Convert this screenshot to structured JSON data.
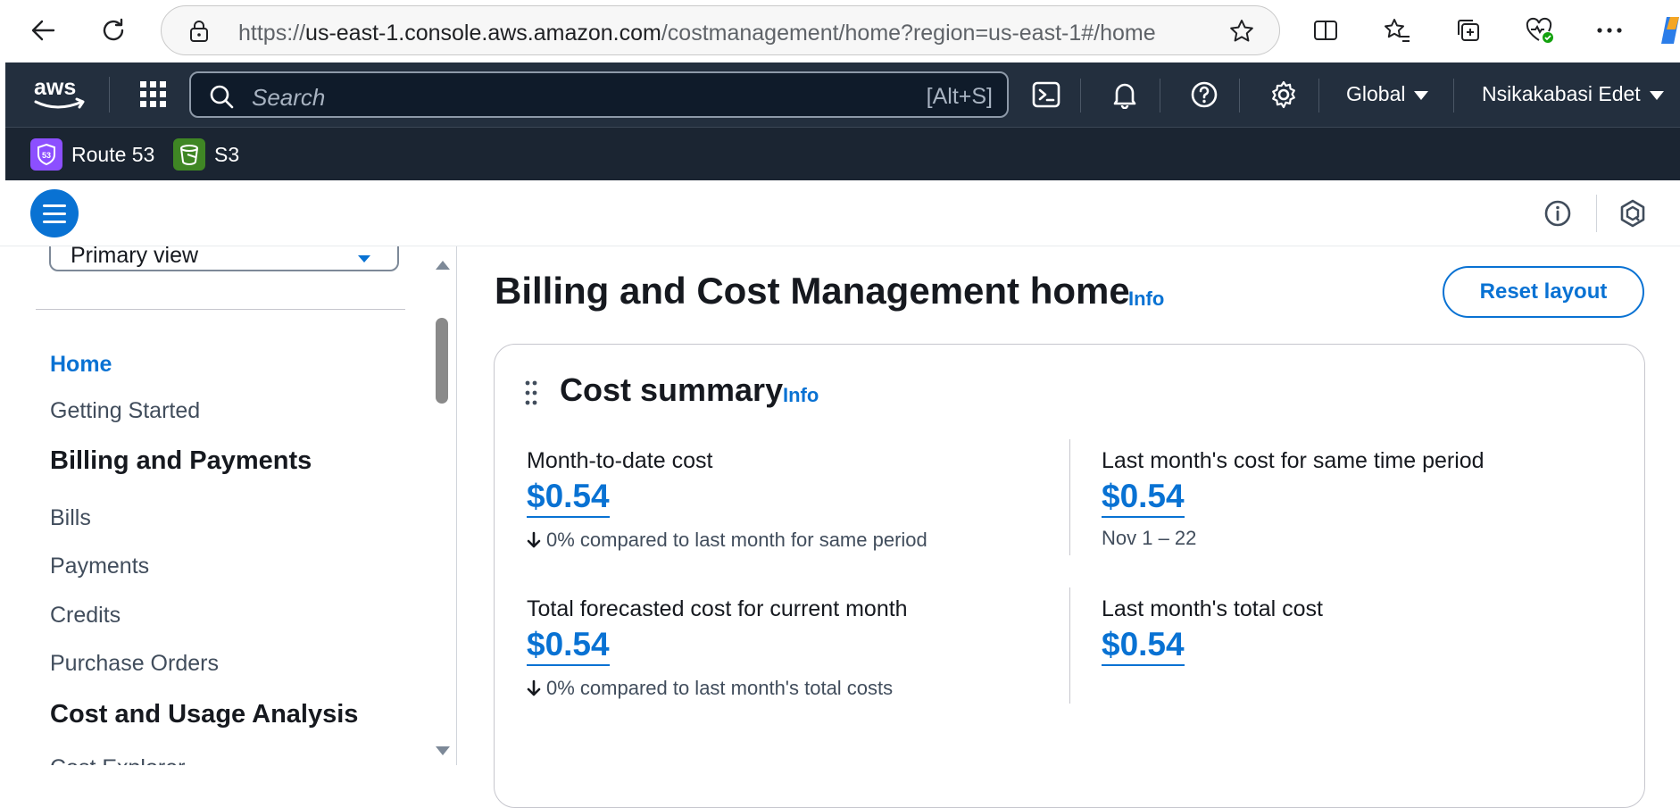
{
  "browser": {
    "url_prefix": "https://",
    "url_domain": "us-east-1.console.aws.amazon.com",
    "url_path": "/costmanagement/home?region=us-east-1#/home"
  },
  "topnav": {
    "search_placeholder": "Search",
    "search_shortcut": "[Alt+S]",
    "region": "Global",
    "user": "Nsikakabasi Edet"
  },
  "favorites": [
    {
      "label": "Route 53",
      "color": "#8c4fff"
    },
    {
      "label": "S3",
      "color": "#3f8624"
    }
  ],
  "sidebar": {
    "view_select": "Primary view",
    "items": [
      {
        "label": "Home",
        "kind": "link-active"
      },
      {
        "label": "Getting Started",
        "kind": "link"
      },
      {
        "label": "Billing and Payments",
        "kind": "heading"
      },
      {
        "label": "Bills",
        "kind": "link"
      },
      {
        "label": "Payments",
        "kind": "link"
      },
      {
        "label": "Credits",
        "kind": "link"
      },
      {
        "label": "Purchase Orders",
        "kind": "link"
      },
      {
        "label": "Cost and Usage Analysis",
        "kind": "heading"
      },
      {
        "label": "Cost Explorer",
        "kind": "link"
      }
    ]
  },
  "main": {
    "title": "Billing and Cost Management home",
    "info": "Info",
    "reset_layout": "Reset layout",
    "card": {
      "title": "Cost summary",
      "info": "Info",
      "metrics": [
        {
          "label": "Month-to-date cost",
          "value": "$0.54",
          "sub": "0% compared to last month for same period"
        },
        {
          "label": "Last month's cost for same time period",
          "value": "$0.54",
          "sub": "Nov 1 – 22"
        },
        {
          "label": "Total forecasted cost for current month",
          "value": "$0.54",
          "sub": "0% compared to last month's total costs"
        },
        {
          "label": "Last month's total cost",
          "value": "$0.54",
          "sub": ""
        }
      ]
    }
  },
  "colors": {
    "accent": "#0972d3",
    "nav_bg": "#232f3e"
  }
}
